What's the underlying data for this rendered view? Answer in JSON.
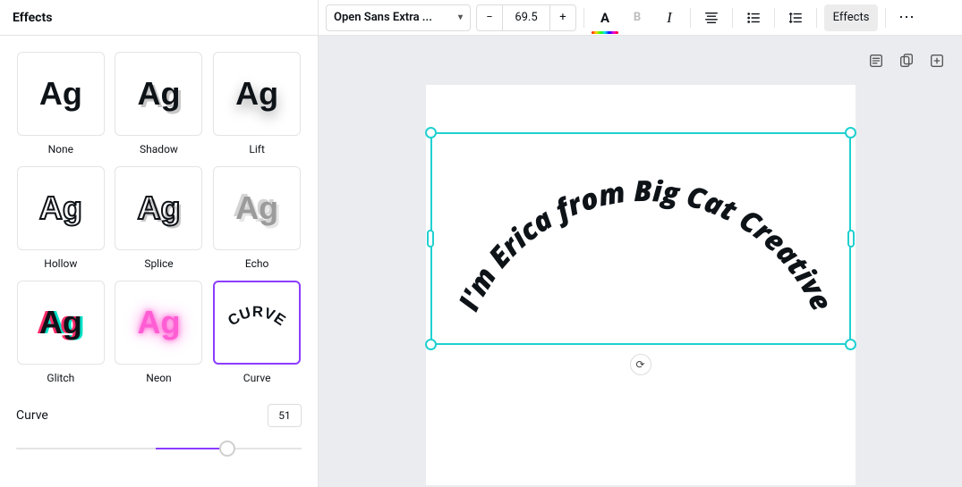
{
  "sidebar": {
    "title": "Effects",
    "effects": [
      {
        "key": "none",
        "label": "None"
      },
      {
        "key": "shadow",
        "label": "Shadow"
      },
      {
        "key": "lift",
        "label": "Lift"
      },
      {
        "key": "hollow",
        "label": "Hollow"
      },
      {
        "key": "splice",
        "label": "Splice"
      },
      {
        "key": "echo",
        "label": "Echo"
      },
      {
        "key": "glitch",
        "label": "Glitch"
      },
      {
        "key": "neon",
        "label": "Neon"
      },
      {
        "key": "curve",
        "label": "Curve",
        "selected": true
      }
    ],
    "sample_text": "Ag",
    "curve_tile_label": "CURVE",
    "curve_control": {
      "label": "Curve",
      "value": "51"
    }
  },
  "toolbar": {
    "font_name": "Open Sans Extra ...",
    "decrement": "−",
    "font_size": "69.5",
    "increment": "+",
    "color_glyph": "A",
    "bold_glyph": "B",
    "italic_glyph": "I",
    "effects_label": "Effects",
    "more_glyph": "⋯"
  },
  "canvas": {
    "curved_text": "I'm Erica from Big Cat Creative",
    "rotate_glyph": "⟳"
  },
  "colors": {
    "selection": "#20d0d0",
    "accent": "#8b3dff"
  }
}
